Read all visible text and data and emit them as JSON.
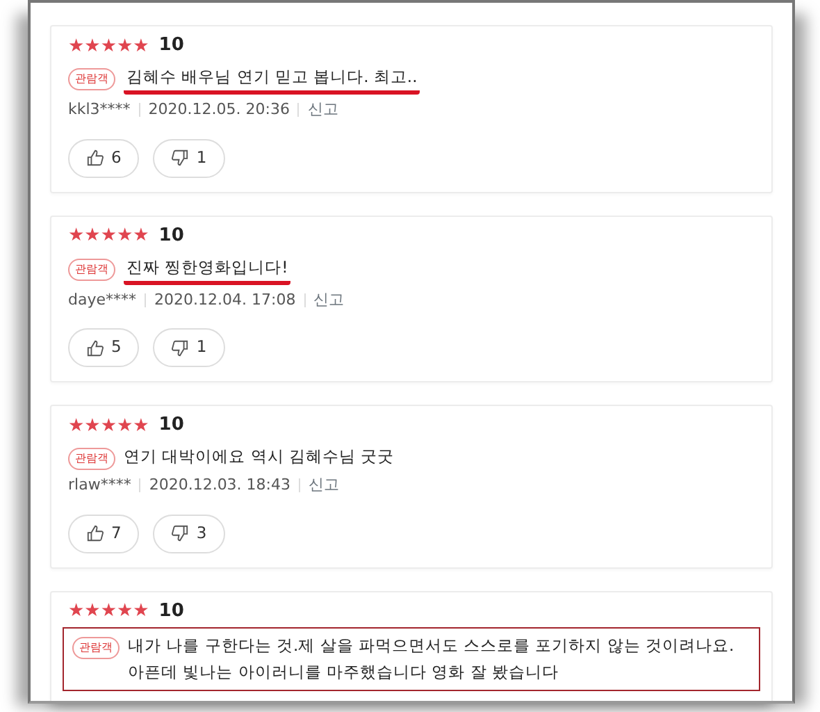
{
  "reviews": [
    {
      "stars": 5,
      "score": "10",
      "badge": "관람객",
      "text": "김혜수 배우님 연기 믿고 봅니다. 최고..",
      "underlined": true,
      "boxed": false,
      "user": "kkl3****",
      "date": "2020.12.05. 20:36",
      "report": "신고",
      "likes": "6",
      "dislikes": "1"
    },
    {
      "stars": 5,
      "score": "10",
      "badge": "관람객",
      "text": "진짜 찡한영화입니다!",
      "underlined": true,
      "boxed": false,
      "user": "daye****",
      "date": "2020.12.04. 17:08",
      "report": "신고",
      "likes": "5",
      "dislikes": "1"
    },
    {
      "stars": 5,
      "score": "10",
      "badge": "관람객",
      "text": "연기 대박이에요 역시 김혜수님 굿굿",
      "underlined": false,
      "boxed": false,
      "user": "rlaw****",
      "date": "2020.12.03. 18:43",
      "report": "신고",
      "likes": "7",
      "dislikes": "3"
    },
    {
      "stars": 5,
      "score": "10",
      "badge": "관람객",
      "text": "내가 나를 구한다는 것.제 살을 파먹으면서도 스스로를 포기하지 않는 것이려나요.아픈데 빛나는 아이러니를 마주했습니다 영화 잘 봤습니다",
      "underlined": false,
      "boxed": true
    }
  ]
}
